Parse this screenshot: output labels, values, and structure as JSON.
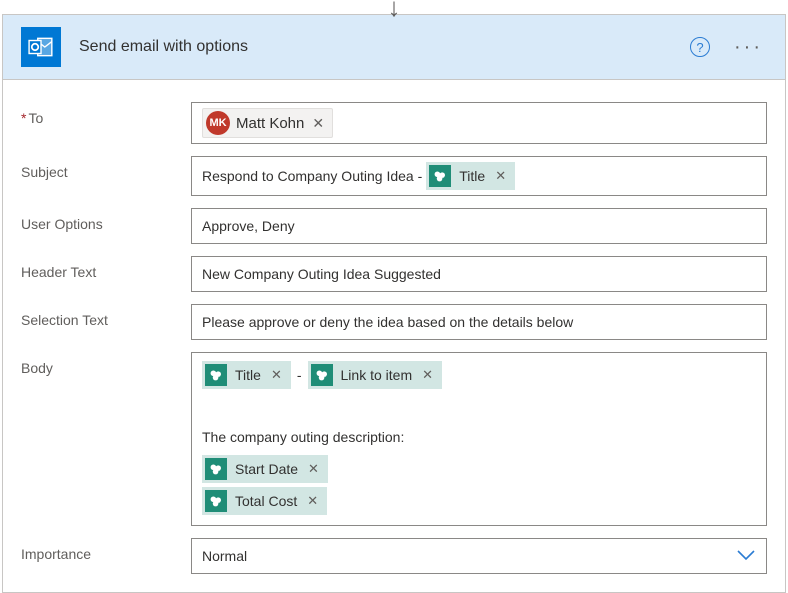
{
  "arrow_glyph": "↓",
  "card": {
    "title": "Send email with options",
    "help_glyph": "?",
    "more_glyph": "···"
  },
  "labels": {
    "to": "To",
    "subject": "Subject",
    "user_options": "User Options",
    "header_text": "Header Text",
    "selection_text": "Selection Text",
    "body": "Body",
    "importance": "Importance",
    "required_marker": "*"
  },
  "values": {
    "to_person": {
      "initials": "MK",
      "name": "Matt Kohn"
    },
    "subject_prefix": "Respond to Company Outing Idea - ",
    "user_options": "Approve, Deny",
    "header_text": "New Company Outing Idea Suggested",
    "selection_text": "Please approve or deny the idea based on the details below",
    "body_desc_text": "The company outing description:",
    "importance": "Normal",
    "dash": "-"
  },
  "tokens": {
    "title": "Title",
    "link_to_item": "Link to item",
    "start_date": "Start Date",
    "total_cost": "Total Cost",
    "remove_glyph": "✕"
  }
}
